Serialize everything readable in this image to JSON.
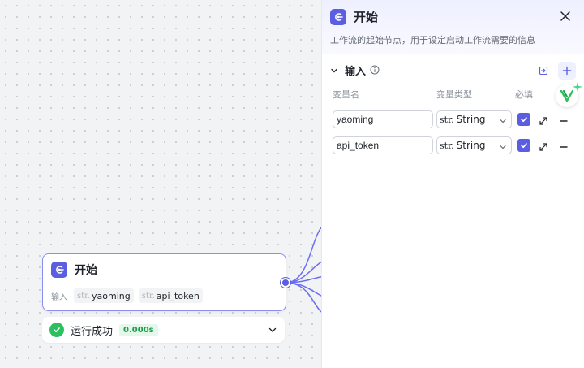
{
  "node": {
    "title": "开始",
    "inputs_label": "输入",
    "tags": [
      {
        "type": "str.",
        "name": "yaoming"
      },
      {
        "type": "str.",
        "name": "api_token"
      }
    ]
  },
  "status": {
    "text": "运行成功",
    "time": "0.000s"
  },
  "panel": {
    "title": "开始",
    "description": "工作流的起始节点，用于设定启动工作流需要的信息",
    "section_title": "输入",
    "columns": {
      "name": "变量名",
      "type": "变量类型",
      "required": "必填"
    },
    "rows": [
      {
        "name": "yaoming",
        "type_prefix": "str.",
        "type": "String",
        "required": true
      },
      {
        "name": "api_token",
        "type_prefix": "str.",
        "type": "String",
        "required": true
      }
    ]
  },
  "colors": {
    "accent": "#5b5ee0",
    "success": "#2dbf5e",
    "badge_green": "#2dbf5e"
  }
}
